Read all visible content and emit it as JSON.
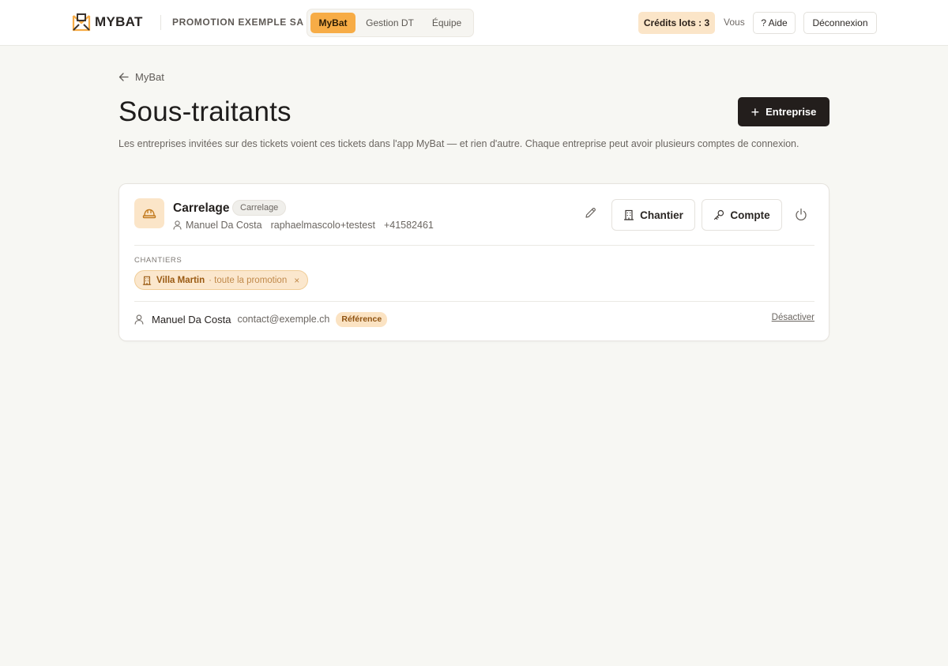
{
  "app": {
    "brand": "MYBAT",
    "org_name": "PROMOTION EXEMPLE SA"
  },
  "nav": {
    "tabs": [
      {
        "label": "MyBat",
        "active": true
      },
      {
        "label": "Gestion DT",
        "active": false
      },
      {
        "label": "Équipe",
        "active": false
      }
    ]
  },
  "header": {
    "credits_label": "Crédits lots : 3",
    "user_label": "Vous",
    "help_label": "? Aide",
    "logout_label": "Déconnexion"
  },
  "page": {
    "back_label": "MyBat",
    "title": "Sous-traitants",
    "add_button_label": "Entreprise",
    "description": "Les entreprises invitées sur des tickets voient ces tickets dans l'app MyBat — et rien d'autre. Chaque entreprise peut avoir plusieurs comptes de connexion."
  },
  "company": {
    "name": "Carrelage",
    "trade": "Carrelage",
    "contact_name": "Manuel Da Costa",
    "email_partial": "raphaelmascolo+testest",
    "phone": "+41582461",
    "btn_chantier": "Chantier",
    "btn_compte": "Compte",
    "sites_label": "CHANTIERS",
    "site": {
      "name": "Villa Martin",
      "scope": "· toute la promotion",
      "remove": "×"
    },
    "account": {
      "name": "Manuel Da Costa",
      "email": "contact@exemple.ch",
      "badge": "Référence",
      "action": "Désactiver"
    }
  },
  "colors": {
    "accent": "#f7ac46",
    "accent_soft": "#fbe5c8",
    "dark_button": "#231e1c",
    "background": "#f7f7f3"
  }
}
